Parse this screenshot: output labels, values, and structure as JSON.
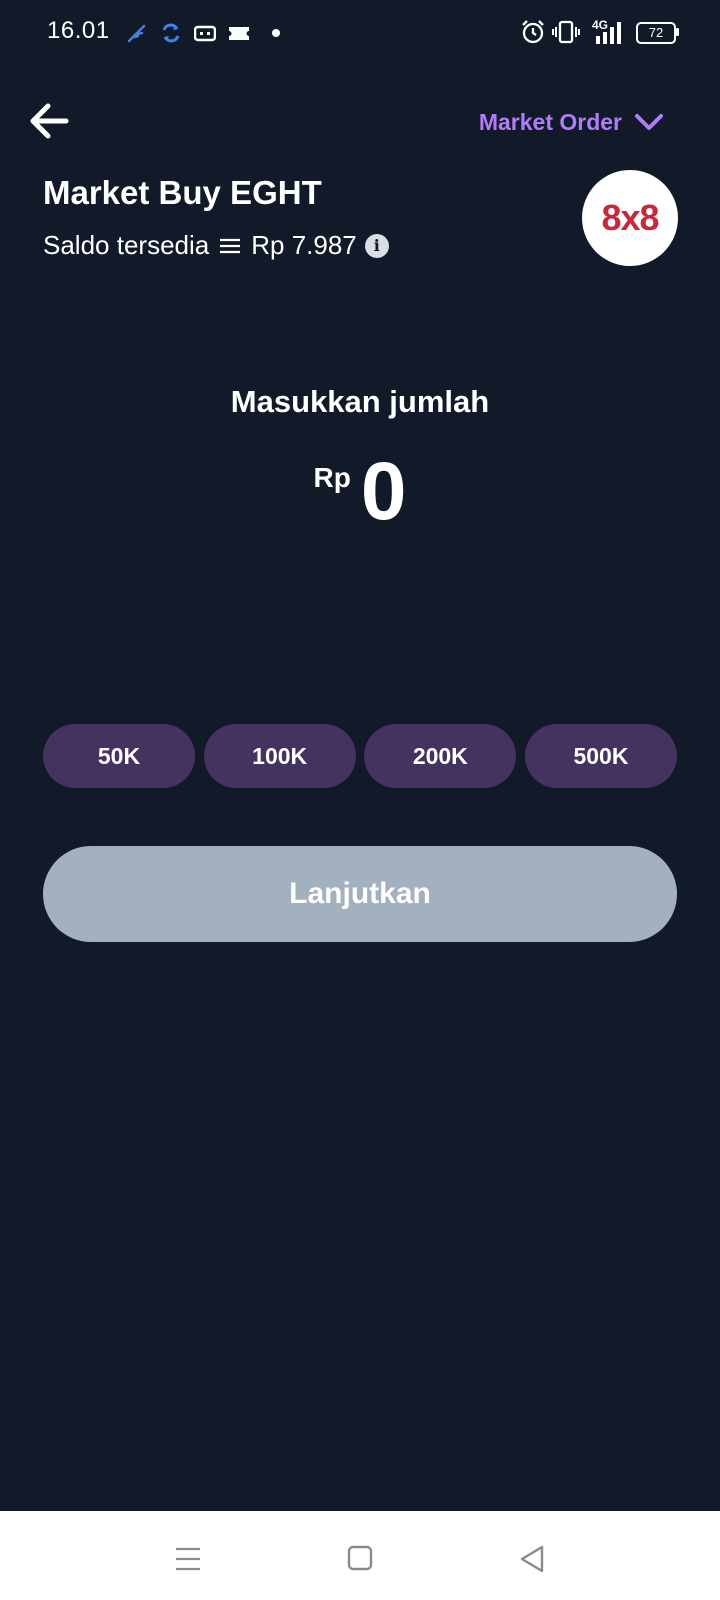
{
  "status_bar": {
    "time": "16.01",
    "network": "4G",
    "battery": "72",
    "icons": [
      "feather-icon",
      "sync-icon",
      "card-icon",
      "ticket-icon",
      "dot-icon",
      "alarm-icon",
      "vibrate-icon",
      "signal-icon",
      "battery-icon"
    ]
  },
  "header": {
    "order_type": "Market Order",
    "title": "Market Buy EGHT",
    "balance_label": "Saldo tersedia",
    "balance_value": "Rp 7.987",
    "logo_text": "8x8"
  },
  "amount": {
    "label": "Masukkan jumlah",
    "currency": "Rp",
    "value": "0"
  },
  "quick_amounts": [
    "50K",
    "100K",
    "200K",
    "500K"
  ],
  "continue_label": "Lanjutkan",
  "colors": {
    "background": "#121a29",
    "accent": "#b17df6",
    "quick_button": "#44325f",
    "continue_disabled": "#a3b1bf",
    "logo": "#c8283c"
  }
}
